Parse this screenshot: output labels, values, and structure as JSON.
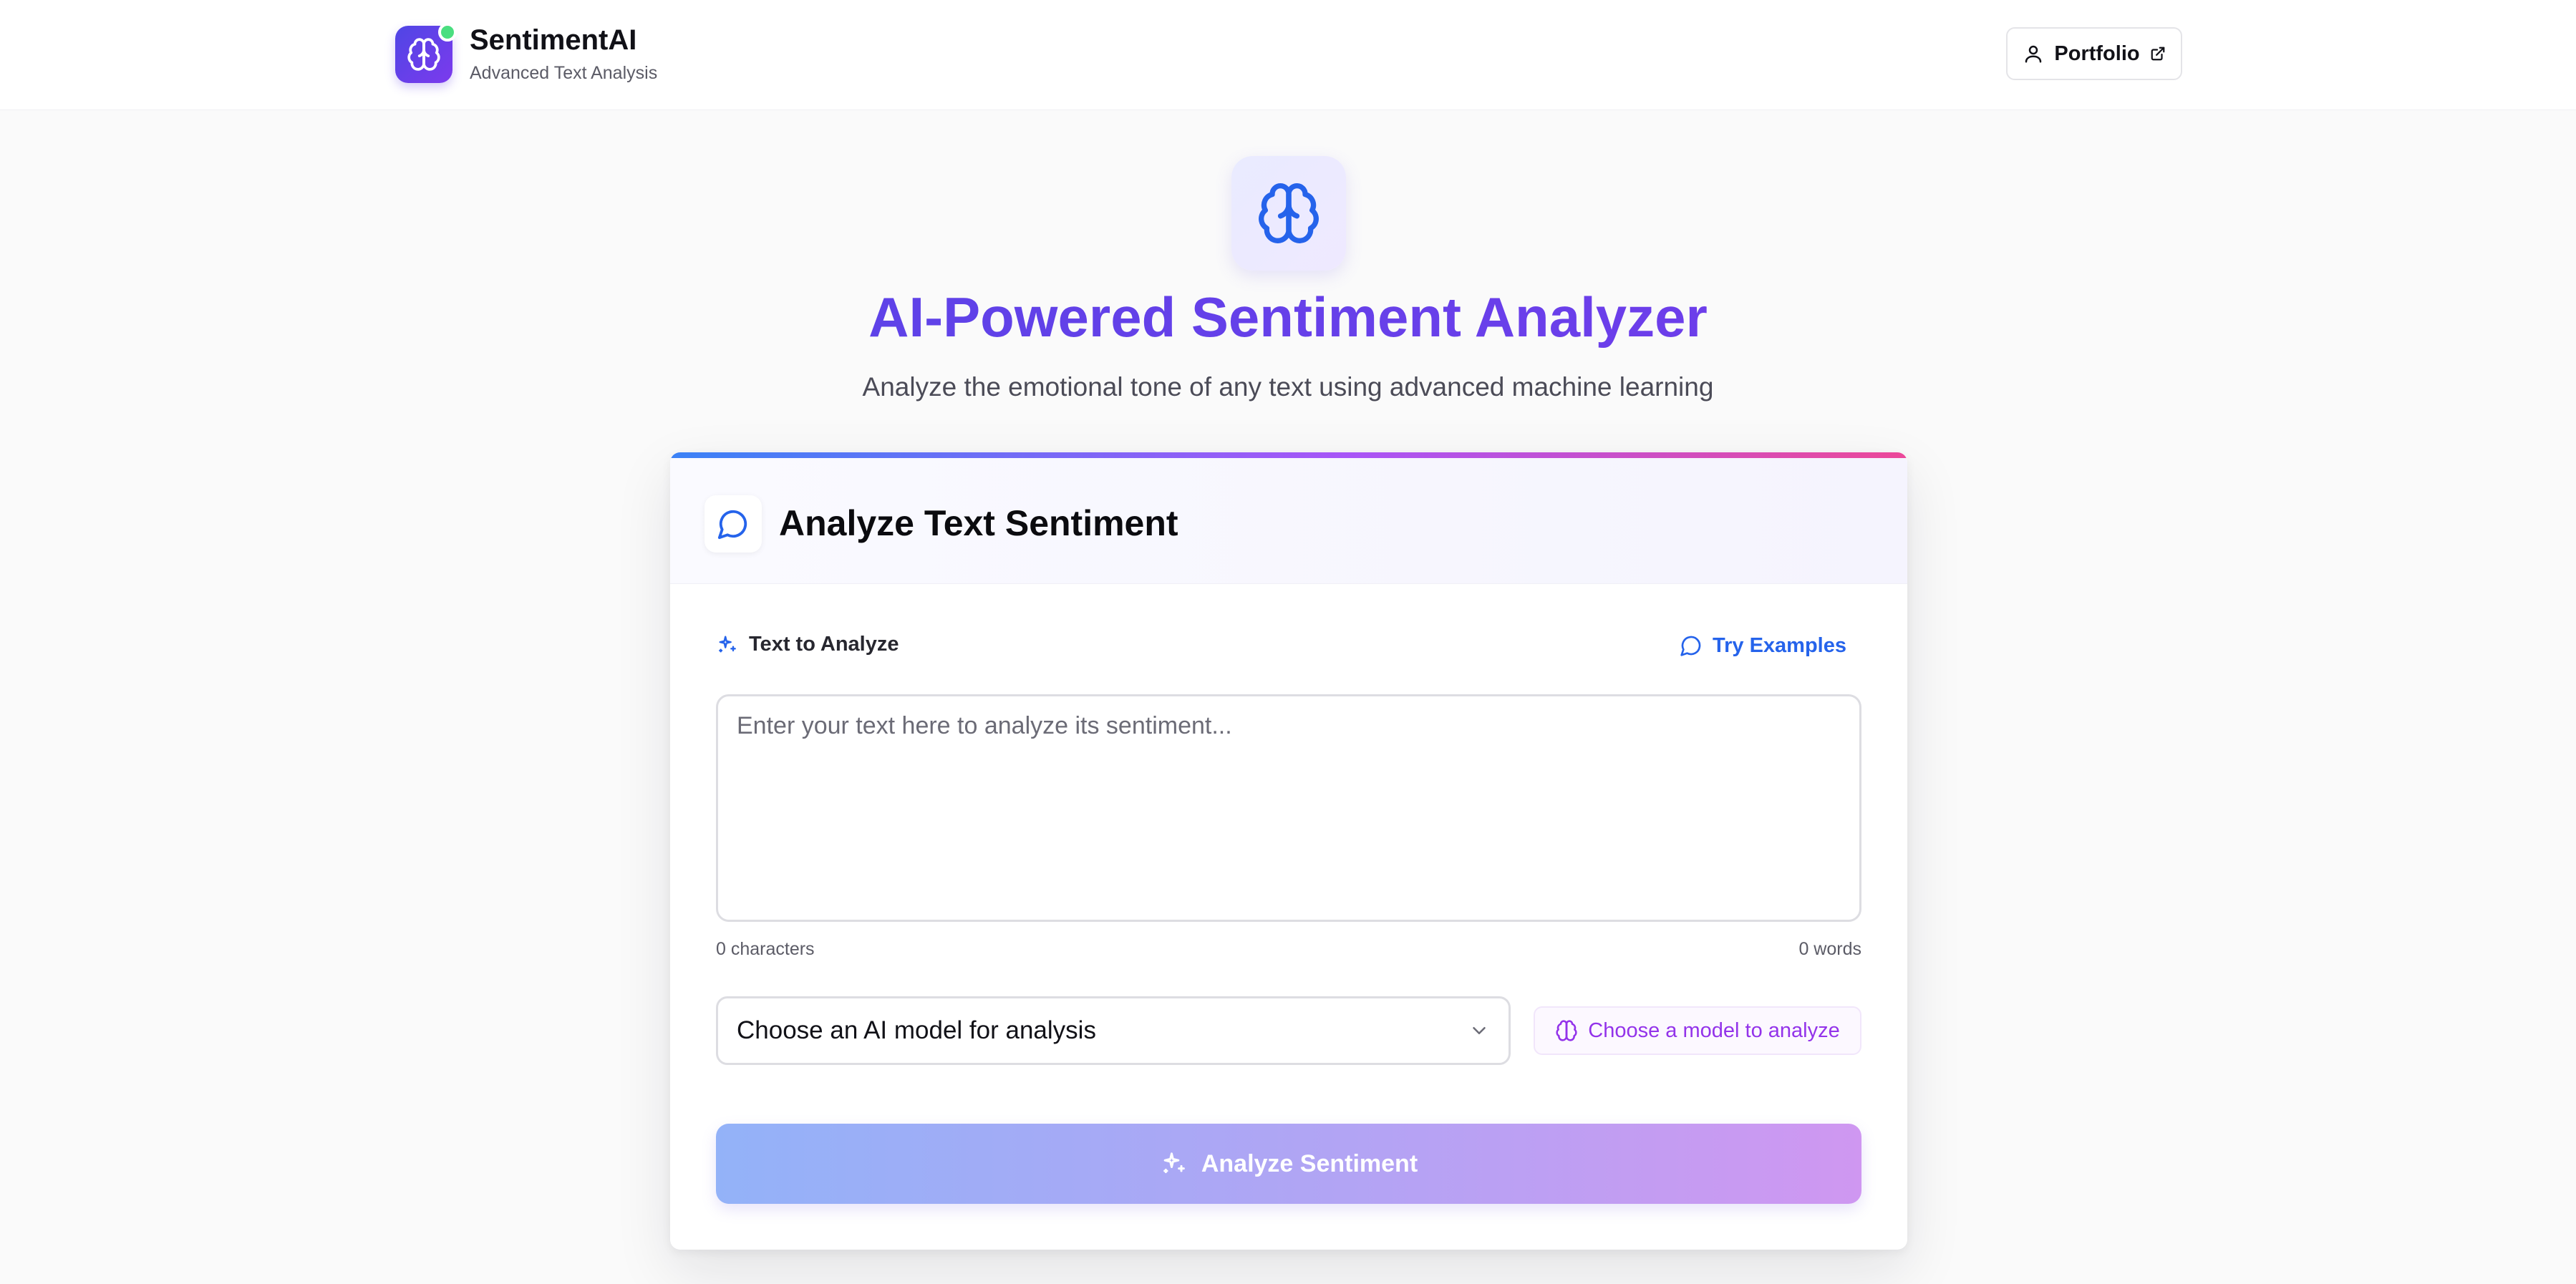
{
  "header": {
    "brand_name": "SentimentAI",
    "brand_subtitle": "Advanced Text Analysis",
    "portfolio_label": "Portfolio",
    "status_color": "#4ade80"
  },
  "hero": {
    "title": "AI-Powered Sentiment Analyzer",
    "subtitle": "Analyze the emotional tone of any text using advanced machine learning",
    "icon": "brain-icon"
  },
  "card": {
    "title": "Analyze Text Sentiment",
    "field_label": "Text to Analyze",
    "examples_label": "Try Examples",
    "textarea": {
      "value": "",
      "placeholder": "Enter your text here to analyze its sentiment..."
    },
    "char_count": "0 characters",
    "word_count": "0 words",
    "model_select": {
      "selected": "Choose an AI model for analysis"
    },
    "model_hint": "Choose a model to analyze",
    "analyze_button": "Analyze Sentiment"
  },
  "colors": {
    "brand_gradient_start": "#4f46e5",
    "brand_gradient_end": "#7c3aed",
    "link_blue": "#2563eb",
    "hint_purple": "#9333ea"
  }
}
